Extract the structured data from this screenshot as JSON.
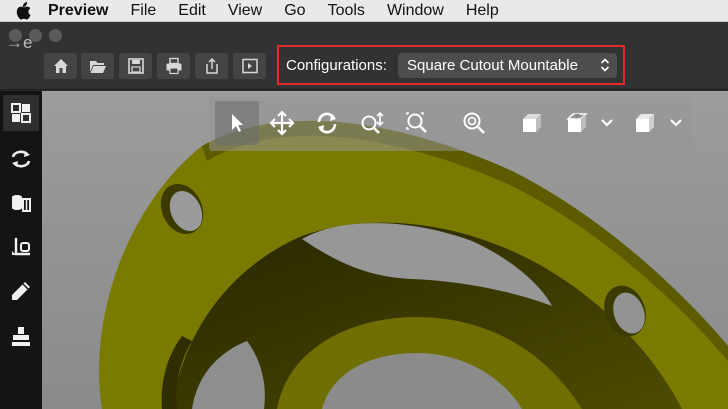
{
  "menubar": {
    "app_name": "Preview",
    "items": [
      "File",
      "Edit",
      "View",
      "Go",
      "Tools",
      "Window",
      "Help"
    ]
  },
  "toolbar": {
    "back_glyph": "→e",
    "configurations_label": "Configurations:",
    "configuration_value": "Square Cutout Mountable"
  },
  "icons": {
    "toolbar": [
      "home-icon",
      "open-folder-icon",
      "save-icon",
      "print-icon",
      "share-icon",
      "sidebar-toggle-icon"
    ],
    "rail": [
      "grid-view-icon",
      "rotate-arrows-icon",
      "cylinder-parts-icon",
      "measure-icon",
      "pencil-icon",
      "stamp-icon"
    ],
    "hud": [
      "select-arrow-icon",
      "pan-icon",
      "rotate-icon",
      "zoom-area-icon",
      "zoom-fit-icon",
      "zoom-icon",
      "shaded-cube-icon",
      "section-cube-icon",
      "display-cube-icon"
    ]
  },
  "colors": {
    "highlight": "#e02a2a",
    "model": "#7b7a00"
  }
}
